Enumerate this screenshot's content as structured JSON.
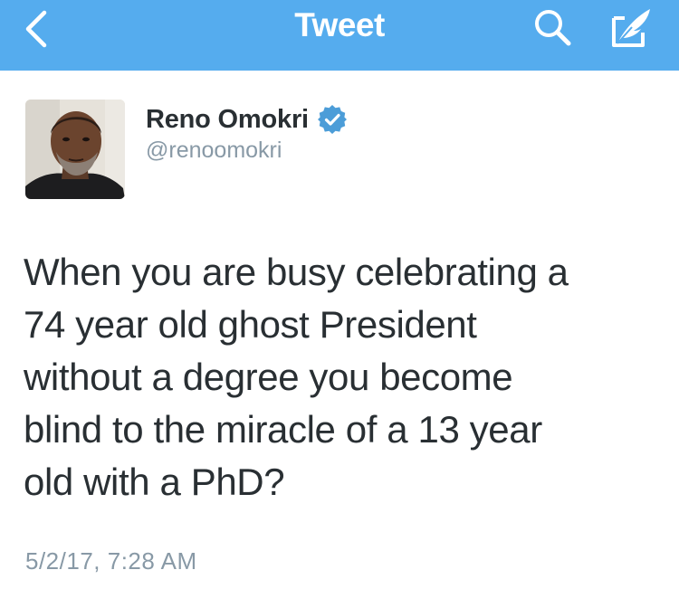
{
  "navbar": {
    "title": "Tweet",
    "bg_color": "#55acee",
    "icons": {
      "back": "chevron-left-icon",
      "search": "search-icon",
      "compose": "compose-tweet-icon"
    }
  },
  "tweet": {
    "author": {
      "name": "Reno Omokri",
      "handle": "@renoomokri",
      "verified": true,
      "verified_color": "#4c9dd8"
    },
    "lines": [
      "When you are busy celebrating a",
      "74 year old ghost President",
      "without a degree you become",
      "blind to the miracle of a 13 year",
      "old with a PhD?"
    ],
    "timestamp": "5/2/17, 7:28 AM"
  }
}
